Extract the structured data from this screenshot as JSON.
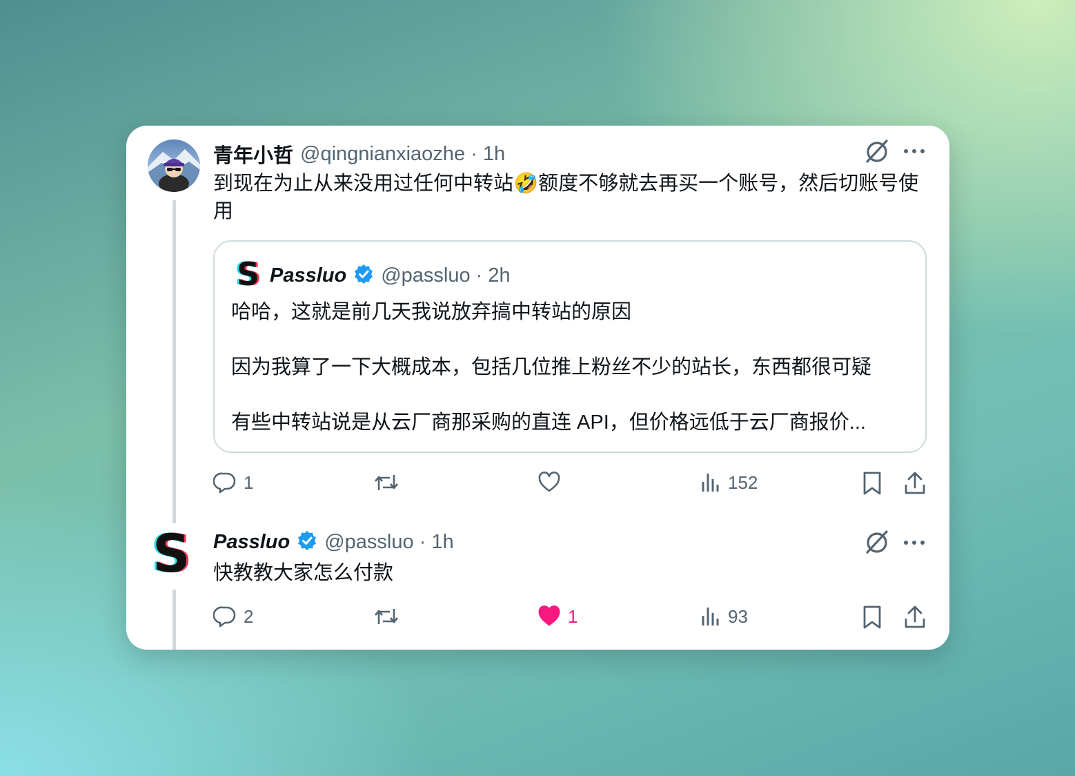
{
  "tweet1": {
    "display_name": "青年小哲",
    "handle_time": "@qingnianxiaozhe · 1h",
    "text": "到现在为止从来没用过任何中转站🤣额度不够就去再买一个账号，然后切账号使用",
    "quote": {
      "display_name": "Passluo",
      "handle_time": "@passluo · 2h",
      "logo_letter": "S",
      "line1": "哈哈，这就是前几天我说放弃搞中转站的原因",
      "line2": "因为我算了一下大概成本，包括几位推上粉丝不少的站长，东西都很可疑",
      "line3": "有些中转站说是从云厂商那采购的直连 API，但价格远低于云厂商报价..."
    },
    "actions": {
      "replies": "1",
      "views": "152"
    }
  },
  "tweet2": {
    "display_name": "Passluo",
    "handle_time": "@passluo · 1h",
    "logo_letter": "S",
    "text": "快教教大家怎么付款",
    "actions": {
      "replies": "2",
      "likes": "1",
      "views": "93"
    }
  },
  "colors": {
    "text_primary": "#0f1419",
    "text_secondary": "#536471",
    "verified_blue": "#1d9bf0",
    "like_pink": "#f91880",
    "border": "#cfd9de"
  },
  "icons": [
    "grok-icon",
    "more-icon",
    "reply-icon",
    "retweet-icon",
    "like-icon",
    "views-icon",
    "bookmark-icon",
    "share-icon",
    "verified-badge-icon"
  ]
}
